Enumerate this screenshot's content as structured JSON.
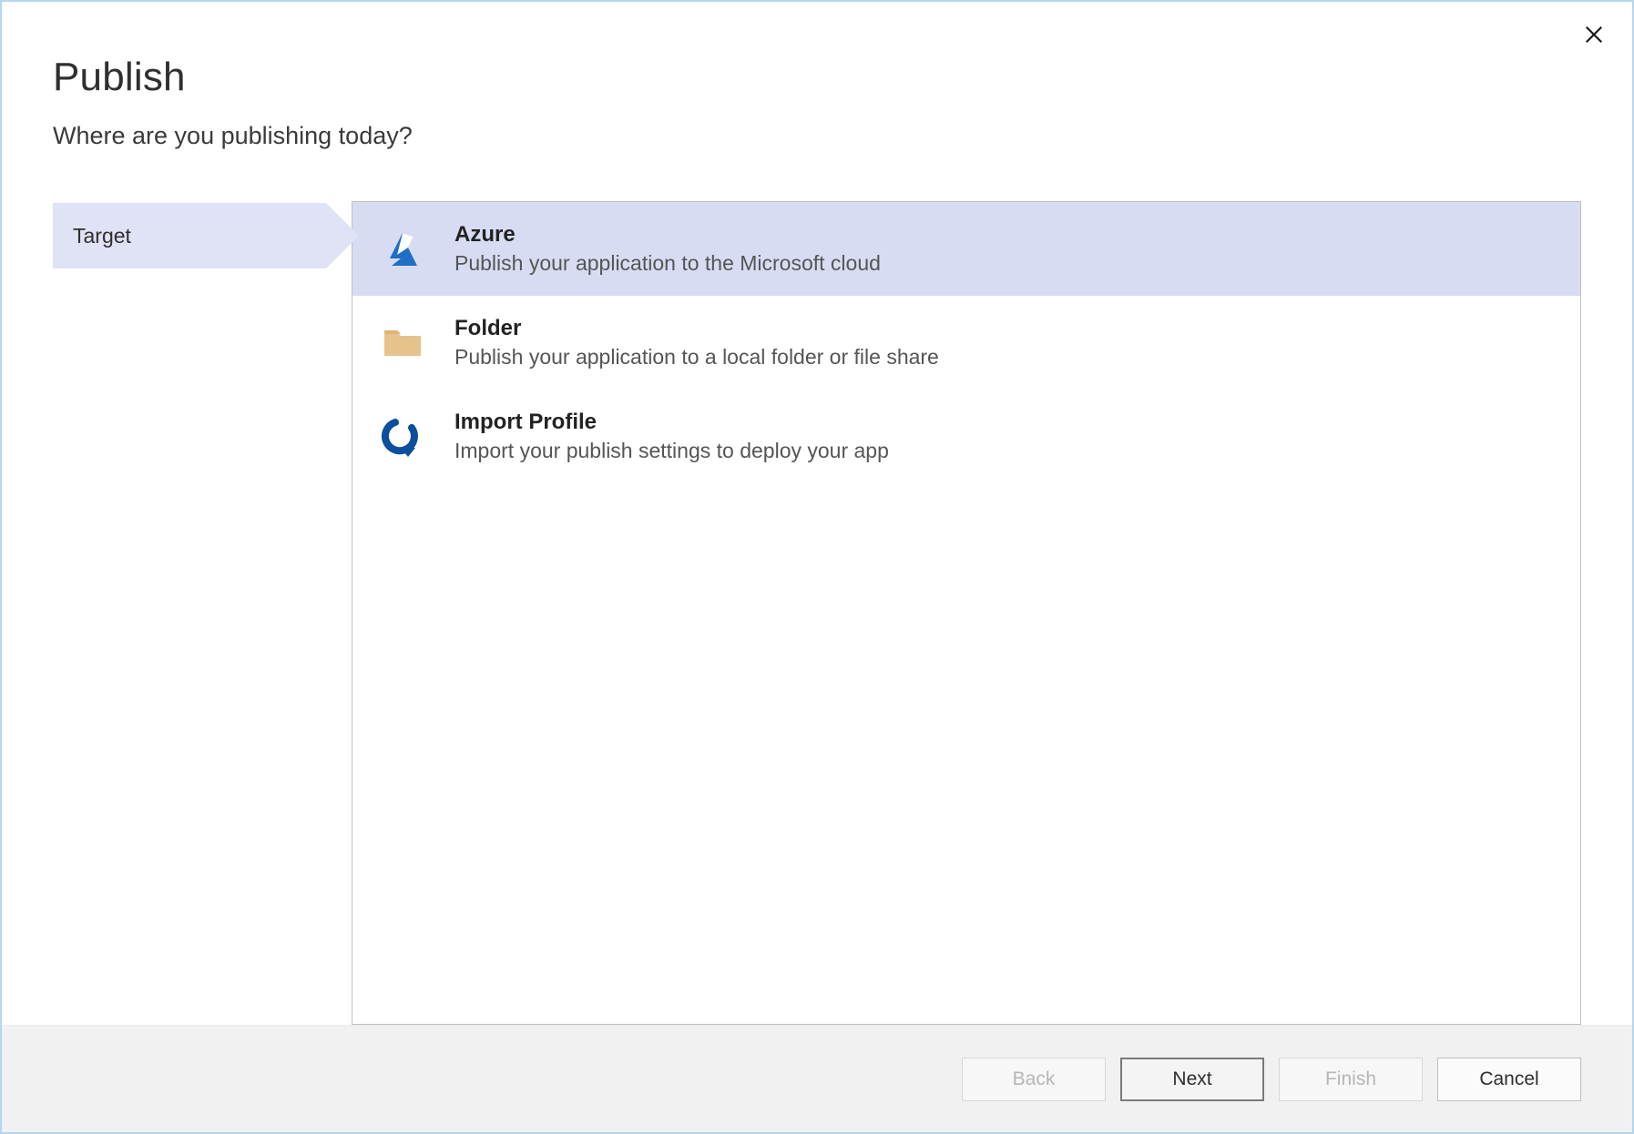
{
  "header": {
    "title": "Publish",
    "subtitle": "Where are you publishing today?"
  },
  "steps": {
    "current": "Target"
  },
  "options": [
    {
      "icon": "azure-icon",
      "title": "Azure",
      "desc": "Publish your application to the Microsoft cloud",
      "selected": true
    },
    {
      "icon": "folder-icon",
      "title": "Folder",
      "desc": "Publish your application to a local folder or file share",
      "selected": false
    },
    {
      "icon": "import-icon",
      "title": "Import Profile",
      "desc": "Import your publish settings to deploy your app",
      "selected": false
    }
  ],
  "footer": {
    "back": "Back",
    "next": "Next",
    "finish": "Finish",
    "cancel": "Cancel"
  }
}
